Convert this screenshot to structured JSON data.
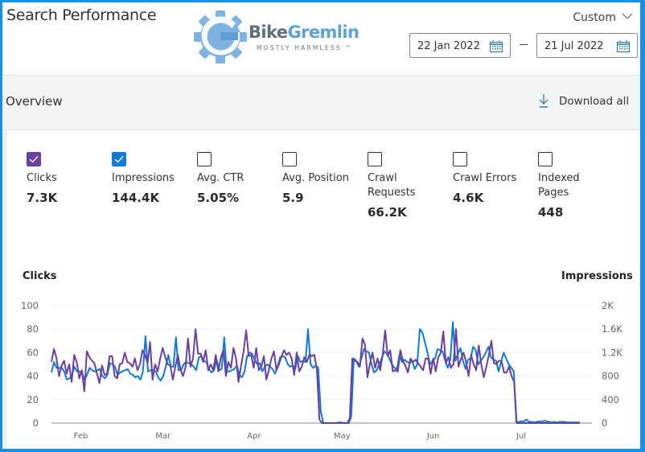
{
  "header": {
    "title": "Search Performance",
    "logo": {
      "name": "BikeGremlin",
      "name_part1": "Bike",
      "name_part2": "Gremlin",
      "tagline": "MOSTLY HARMLESS ™"
    },
    "range_select": "Custom",
    "start_date": "22 Jan 2022",
    "end_date": "21 Jul 2022",
    "range_separator": "–"
  },
  "overview": {
    "title": "Overview",
    "download_label": "Download all"
  },
  "colors": {
    "clicks": "#6b3fa0",
    "impressions": "#0f7bd6",
    "frame": "#1a8fe3"
  },
  "metrics": [
    {
      "label": "Clicks",
      "value": "7.3K",
      "checked": true,
      "color": "#6b3fa0"
    },
    {
      "label": "Impressions",
      "value": "144.4K",
      "checked": true,
      "color": "#0f7bd6"
    },
    {
      "label": "Avg. CTR",
      "value": "5.05%",
      "checked": false
    },
    {
      "label": "Avg. Position",
      "value": "5.9",
      "checked": false
    },
    {
      "label": "Crawl Requests",
      "value": "66.2K",
      "checked": false
    },
    {
      "label": "Crawl Errors",
      "value": "4.6K",
      "checked": false
    },
    {
      "label": "Indexed Pages",
      "value": "448",
      "checked": false
    }
  ],
  "chart_data": {
    "type": "line",
    "title": "",
    "ylabel_left": "Clicks",
    "ylabel_right": "Impressions",
    "x_start": "2022-01-22",
    "x_end": "2022-07-21",
    "x_ticks": [
      "Feb",
      "Mar",
      "Apr",
      "May",
      "Jun",
      "Jul"
    ],
    "y_left": {
      "range": [
        0,
        100
      ],
      "ticks": [
        "0",
        "20",
        "40",
        "60",
        "80",
        "100"
      ]
    },
    "y_right": {
      "range": [
        0,
        2000
      ],
      "ticks": [
        "0",
        "400",
        "800",
        "1.2K",
        "1.6K",
        "2K"
      ]
    },
    "grid": true,
    "legend": "none",
    "series": [
      {
        "name": "Clicks",
        "axis": "left",
        "color": "#6b3fa0",
        "values": [
          52,
          63,
          55,
          40,
          49,
          53,
          42,
          50,
          35,
          58,
          52,
          38,
          45,
          27,
          61,
          56,
          53,
          51,
          42,
          34,
          49,
          41,
          42,
          57,
          57,
          40,
          38,
          50,
          51,
          60,
          52,
          51,
          48,
          55,
          45,
          50,
          62,
          58,
          51,
          69,
          37,
          50,
          44,
          55,
          64,
          56,
          50,
          49,
          37,
          48,
          58,
          46,
          40,
          47,
          72,
          48,
          55,
          80,
          59,
          59,
          52,
          62,
          45,
          50,
          45,
          58,
          44,
          56,
          62,
          40,
          52,
          47,
          64,
          55,
          35,
          49,
          61,
          79,
          57,
          58,
          47,
          64,
          45,
          48,
          57,
          37,
          45,
          55,
          61,
          45,
          50,
          57,
          62,
          58,
          60,
          55,
          41,
          60,
          44,
          48,
          56,
          52,
          58,
          57,
          58,
          45,
          3,
          0,
          0,
          0,
          0,
          0,
          0,
          0,
          0,
          0,
          0,
          0,
          4,
          55,
          53,
          52,
          48,
          72,
          67,
          39,
          51,
          60,
          47,
          55,
          45,
          58,
          79,
          57,
          62,
          44,
          45,
          44,
          62,
          53,
          49,
          43,
          55,
          52,
          54,
          51,
          48,
          45,
          55,
          55,
          42,
          55,
          44,
          56,
          60,
          78,
          51,
          56,
          47,
          50,
          80,
          48,
          55,
          60,
          52,
          40,
          58,
          50,
          45,
          66,
          50,
          39,
          48,
          58,
          70,
          51,
          50,
          53,
          53,
          43,
          43,
          48,
          40,
          35,
          0,
          0,
          0,
          0,
          0,
          0,
          0,
          0,
          0,
          0,
          0,
          0,
          0,
          0,
          0,
          0,
          0,
          0,
          0,
          0,
          0,
          0,
          0,
          0,
          0,
          0
        ]
      },
      {
        "name": "Impressions",
        "axis": "right",
        "color": "#0f7bd6",
        "values": [
          860,
          1040,
          940,
          940,
          940,
          880,
          740,
          760,
          800,
          960,
          880,
          880,
          860,
          740,
          820,
          940,
          900,
          880,
          900,
          920,
          800,
          760,
          820,
          1020,
          1000,
          960,
          820,
          860,
          880,
          900,
          920,
          840,
          820,
          780,
          800,
          740,
          880,
          1480,
          880,
          900,
          900,
          880,
          780,
          720,
          800,
          960,
          1160,
          960,
          960,
          1460,
          900,
          900,
          1000,
          1040,
          1020,
          1000,
          960,
          900,
          1120,
          1140,
          1060,
          1040,
          920,
          860,
          900,
          1080,
          900,
          920,
          1460,
          880,
          880,
          900,
          920,
          980,
          820,
          780,
          880,
          1140,
          1200,
          1180,
          1080,
          1000,
          1020,
          880,
          960,
          1000,
          960,
          920,
          840,
          960,
          1120,
          1140,
          1120,
          1000,
          960,
          980,
          920,
          1140,
          1040,
          1060,
          1040,
          1600,
          1000,
          940,
          980,
          940,
          200,
          0,
          0,
          0,
          0,
          0,
          0,
          10,
          10,
          0,
          0,
          0,
          100,
          1100,
          1060,
          960,
          1100,
          1260,
          1220,
          1200,
          1000,
          860,
          900,
          1000,
          1100,
          1220,
          1180,
          1100,
          1000,
          940,
          920,
          1160,
          1040,
          1080,
          1040,
          1020,
          1060,
          920,
          1000,
          1600,
          1540,
          1380,
          1200,
          1000,
          1060,
          1100,
          1260,
          1240,
          1220,
          1060,
          940,
          1080,
          1720,
          1060,
          1180,
          1280,
          1060,
          920,
          1080,
          1100,
          1300,
          1240,
          1000,
          1060,
          1120,
          1200,
          1300,
          1120,
          1080,
          1060,
          880,
          1040,
          1200,
          1100,
          1000,
          940,
          880,
          10,
          20,
          30,
          30,
          60,
          20,
          20,
          10,
          20,
          30,
          20,
          40,
          30,
          20,
          10,
          20,
          10,
          20,
          20,
          20,
          10,
          10,
          10,
          10,
          10,
          10
        ]
      }
    ]
  }
}
